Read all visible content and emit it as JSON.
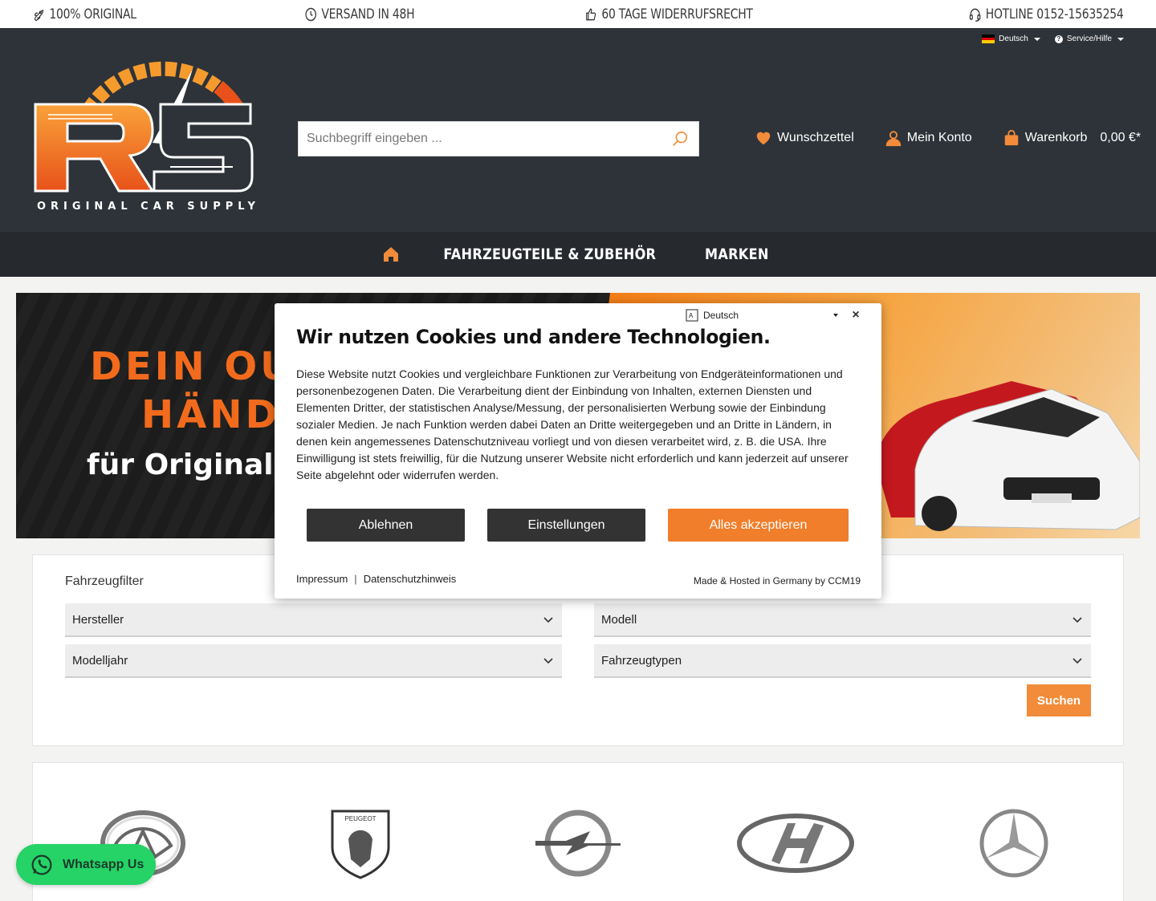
{
  "usp": [
    {
      "icon": "rocket-icon",
      "label": "100% ORIGINAL"
    },
    {
      "icon": "clock-icon",
      "label": "VERSAND IN 48H"
    },
    {
      "icon": "thumbs-up-icon",
      "label": "60 TAGE WIDERRUFSRECHT"
    },
    {
      "icon": "headset-icon",
      "label": "HOTLINE 0152-15635254"
    }
  ],
  "top_links": {
    "language": "Deutsch",
    "service": "Service/Hilfe"
  },
  "logo": {
    "letters": "RS",
    "tagline": "ORIGINAL CAR SUPPLY"
  },
  "search": {
    "placeholder": "Suchbegriff eingeben ..."
  },
  "header_actions": {
    "wishlist": "Wunschzettel",
    "account": "Mein Konto",
    "cart": "Warenkorb",
    "cart_price": "0,00 €*"
  },
  "nav": {
    "items": [
      "FAHRZEUGTEILE & ZUBEHÖR",
      "MARKEN"
    ]
  },
  "banner": {
    "line1": "DEIN OU",
    "line2": "HÄND",
    "line3": "für Original A"
  },
  "filter": {
    "title": "Fahrzeugfilter",
    "selects": {
      "manufacturer": "Hersteller",
      "model": "Modell",
      "year": "Modelljahr",
      "vehicle_types": "Fahrzeugtypen"
    },
    "button": "Suchen"
  },
  "brands": [
    "mazda-logo",
    "peugeot-logo",
    "opel-logo",
    "hyundai-logo",
    "mercedes-logo"
  ],
  "brand_text": {
    "peugeot": "PEUGEOT"
  },
  "whatsapp": {
    "label": "Whatsapp Us"
  },
  "cookie": {
    "language": "Deutsch",
    "title": "Wir nutzen Cookies und andere Technologien.",
    "text": "Diese Website nutzt Cookies und vergleichbare Funktionen zur Verarbeitung von Endgeräteinformationen und personenbezogenen Daten. Die Verarbeitung dient der Einbindung von Inhalten, externen Diensten und Elementen Dritter, der statistischen Analyse/Messung, der personalisierten Werbung sowie der Einbindung sozialer Medien. Je nach Funktion werden dabei Daten an Dritte weitergegeben und an Dritte in Ländern, in denen kein angemessenes Datenschutzniveau vorliegt und von diesen verarbeitet wird, z. B. die USA. Ihre Einwilligung ist stets freiwillig, für die Nutzung unserer Website nicht erforderlich und kann jederzeit auf unserer Seite abgelehnt oder widerrufen werden.",
    "buttons": {
      "decline": "Ablehnen",
      "settings": "Einstellungen",
      "accept": "Alles akzeptieren"
    },
    "links": {
      "imprint": "Impressum",
      "separator": "|",
      "privacy": "Datenschutzhinweis"
    },
    "made": "Made & Hosted in Germany by CCM19"
  },
  "colors": {
    "accent": "#f28c3a",
    "header_bg": "#2e3339",
    "nav_bg": "#262a2f",
    "whatsapp": "#25d366"
  }
}
